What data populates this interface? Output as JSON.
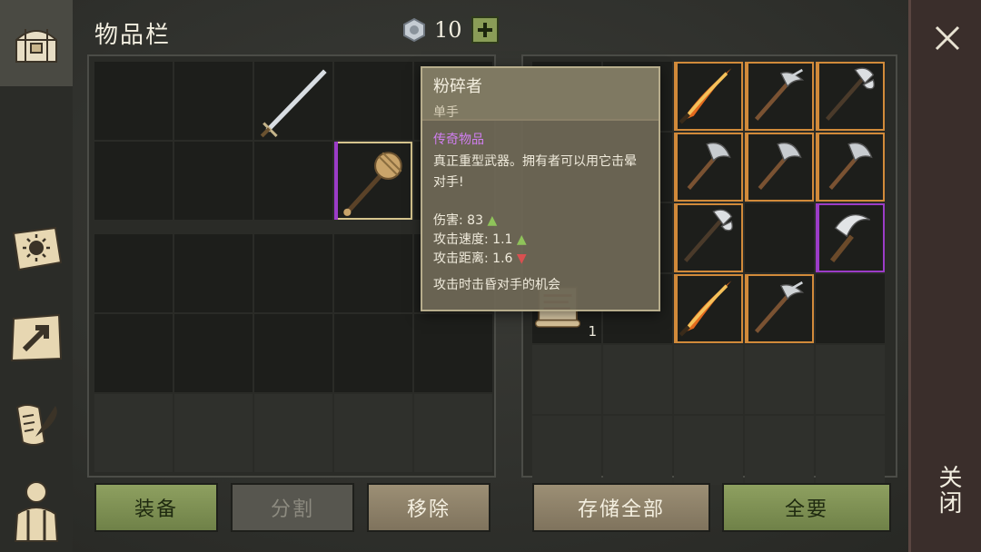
{
  "header": {
    "title": "物品栏",
    "coin_count": "10",
    "plus_label": "+"
  },
  "sidebar": {
    "items": [
      {
        "icon": "chest-icon",
        "active": true
      },
      {
        "icon": "sun-book-icon"
      },
      {
        "icon": "craft-map-icon"
      },
      {
        "icon": "quill-scroll-icon"
      },
      {
        "icon": "character-icon"
      }
    ]
  },
  "inventory": {
    "slots_top": [
      "",
      "",
      "sword",
      "",
      "",
      "",
      "",
      "",
      "mace",
      ""
    ],
    "slots_bottom_rows": 3,
    "buttons": {
      "equip": "装备",
      "split": "分割",
      "remove": "移除"
    }
  },
  "storage": {
    "slots": [
      "",
      "",
      "flaming-sword",
      "pickaxe",
      "double-axe",
      "",
      "",
      "hatchet",
      "hatchet",
      "hatchet",
      "",
      "",
      "double-axe",
      "",
      "scythe",
      "scroll",
      "",
      "flaming-sword",
      "pickaxe",
      ""
    ],
    "scroll_count": "1",
    "buttons": {
      "store_all": "存储全部",
      "take_all": "全要"
    }
  },
  "tooltip": {
    "name": "粉碎者",
    "type": "单手",
    "rarity": "传奇物品",
    "description": "真正重型武器。拥有者可以用它击晕对手!",
    "stats": [
      {
        "label": "伤害:",
        "value": "83",
        "trend": "▲"
      },
      {
        "label": "攻击速度:",
        "value": "1.1",
        "trend": "▲"
      },
      {
        "label": "攻击距离:",
        "value": "1.6",
        "trend": "▼"
      }
    ],
    "effect": "攻击时击昏对手的机会"
  },
  "close": {
    "label": "关闭"
  },
  "colors": {
    "legendary": "#9b3cc7",
    "rare": "#d18a3a",
    "accent": "#8ea060"
  }
}
